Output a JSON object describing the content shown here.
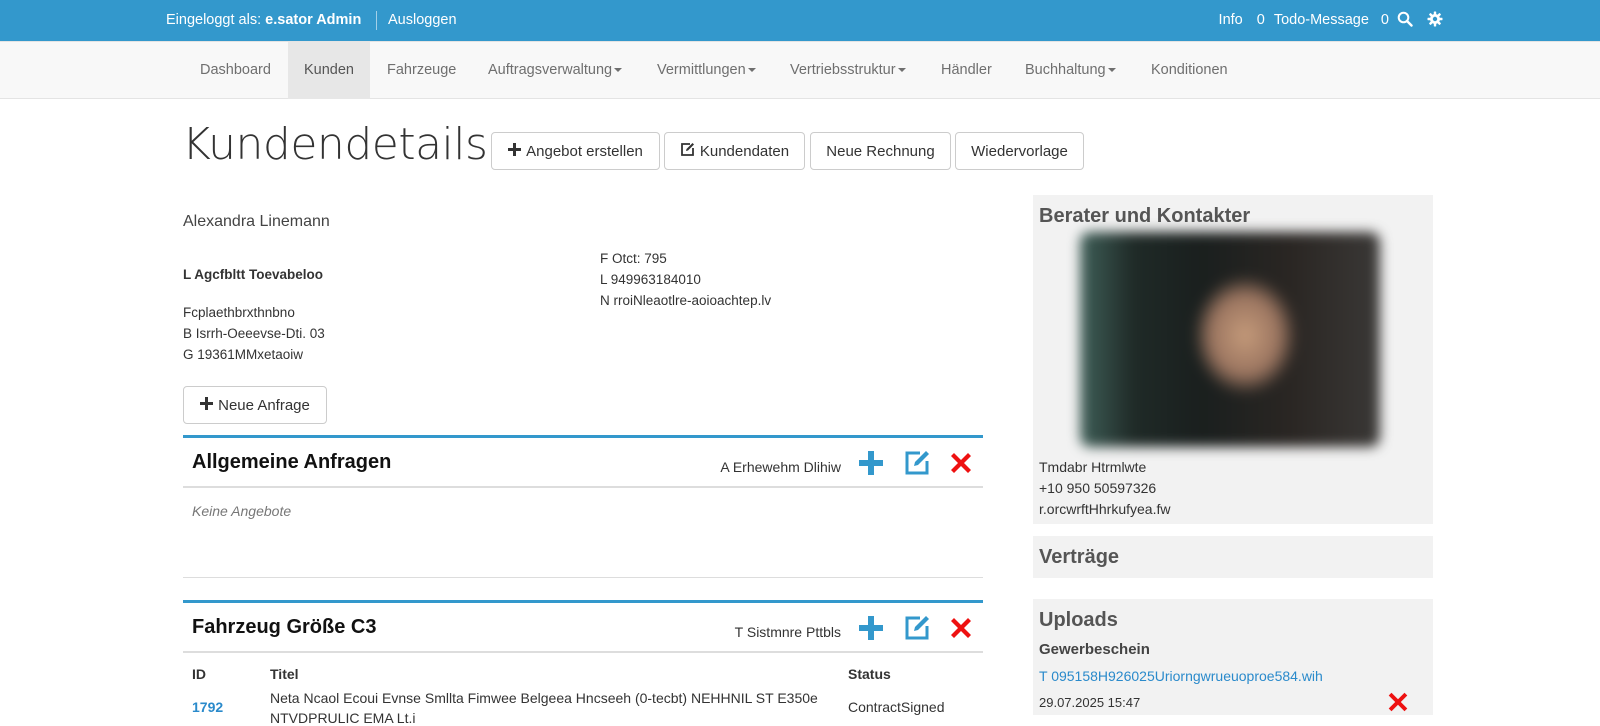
{
  "topbar": {
    "login_prefix": "Eingeloggt als:",
    "login_user": "e.sator Admin",
    "logout": "Ausloggen",
    "info": "Info",
    "info_count": "0",
    "todo": "Todo-Message",
    "todo_count": "0",
    "icons": [
      "search-icon",
      "gear-icon"
    ]
  },
  "nav": {
    "items": [
      {
        "label": "Dashboard",
        "dropdown": false
      },
      {
        "label": "Kunden",
        "dropdown": false,
        "active": true
      },
      {
        "label": "Fahrzeuge",
        "dropdown": false
      },
      {
        "label": "Auftragsverwaltung",
        "dropdown": true
      },
      {
        "label": "Vermittlungen",
        "dropdown": true
      },
      {
        "label": "Vertriebsstruktur",
        "dropdown": true
      },
      {
        "label": "Händler",
        "dropdown": false
      },
      {
        "label": "Buchhaltung",
        "dropdown": true
      },
      {
        "label": "Konditionen",
        "dropdown": false
      }
    ]
  },
  "header": {
    "title": "Kundendetails",
    "buttons": {
      "angebot": "Angebot erstellen",
      "kundendaten": "Kundendaten",
      "rechnung": "Neue Rechnung",
      "wiedervorlage": "Wiedervorlage"
    }
  },
  "customer": {
    "name": "Alexandra Linemann",
    "company": "L Agcfbltt Toevabeloo",
    "address": [
      "Fcplaethbrxthnbno",
      "B Isrrh-Oeeevse-Dti. 03",
      "G 19361MMxetaoiw"
    ],
    "contact": [
      "F Otct: 795",
      "L 949963184010",
      "N rroiNleaotlre-aoioachtep.lv"
    ],
    "new_request": "Neue Anfrage"
  },
  "sections": {
    "general": {
      "title": "Allgemeine Anfragen",
      "meta": "A Erhewehm Dlihiw",
      "empty": "Keine Angebote"
    },
    "vehicle": {
      "title": "Fahrzeug Größe C3",
      "meta": "T Sistmnre Pttbls",
      "columns": {
        "id": "ID",
        "title": "Titel",
        "status": "Status"
      },
      "rows": [
        {
          "id": "1792",
          "title_line1": "Neta Ncaol Ecoui Evnse Smllta Fimwee Belgeea Hncseeh (0-tecbt) NEHHNIL ST E350e",
          "title_line2": "NTVDPRULIC EMA Lt.i",
          "status": "ContractSigned"
        }
      ]
    }
  },
  "sidebar": {
    "advisor": {
      "title": "Berater und Kontakter",
      "name": "Tmdabr Htrmlwte",
      "phone": "+10 950 50597326",
      "email": "r.orcwrftHhrkufyea.fw"
    },
    "contracts": {
      "title": "Verträge"
    },
    "uploads": {
      "title": "Uploads",
      "category": "Gewerbeschein",
      "file": "T 095158H926025Uriorngwrueuoproe584.wih",
      "date": "29.07.2025 15:47"
    }
  },
  "colors": {
    "primary": "#3398cc",
    "danger": "#ee1111",
    "link": "#2a8acb"
  }
}
